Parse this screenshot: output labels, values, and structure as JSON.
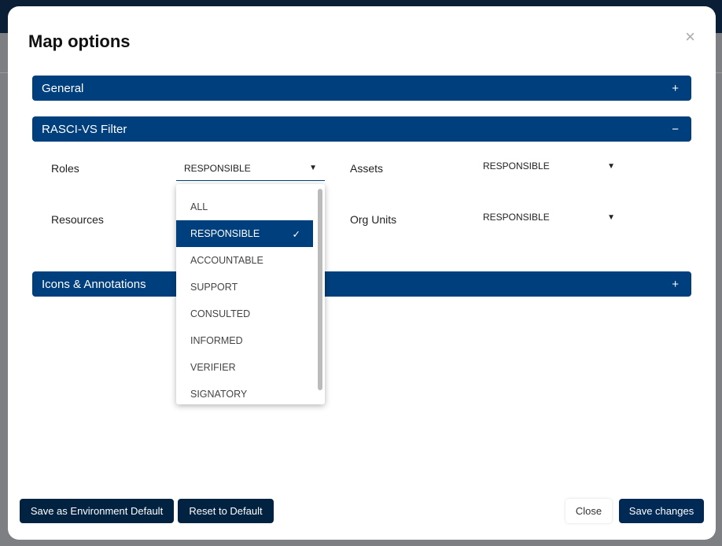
{
  "modal": {
    "title": "Map options",
    "close_icon": "×"
  },
  "panels": [
    {
      "label": "General",
      "toggle": "+"
    },
    {
      "label": "RASCI-VS Filter",
      "toggle": "−"
    },
    {
      "label": "Icons & Annotations",
      "toggle": "+"
    }
  ],
  "filters": {
    "roles": {
      "label": "Roles",
      "value": "RESPONSIBLE"
    },
    "assets": {
      "label": "Assets",
      "value": "RESPONSIBLE"
    },
    "resources": {
      "label": "Resources"
    },
    "org_units": {
      "label": "Org Units",
      "value": "RESPONSIBLE"
    }
  },
  "dropdown": {
    "options": [
      "ALL",
      "RESPONSIBLE",
      "ACCOUNTABLE",
      "SUPPORT",
      "CONSULTED",
      "INFORMED",
      "VERIFIER",
      "SIGNATORY"
    ],
    "selected_check": "✓"
  },
  "footer": {
    "save_env": "Save as Environment Default",
    "reset": "Reset to Default",
    "close": "Close",
    "save": "Save changes"
  }
}
